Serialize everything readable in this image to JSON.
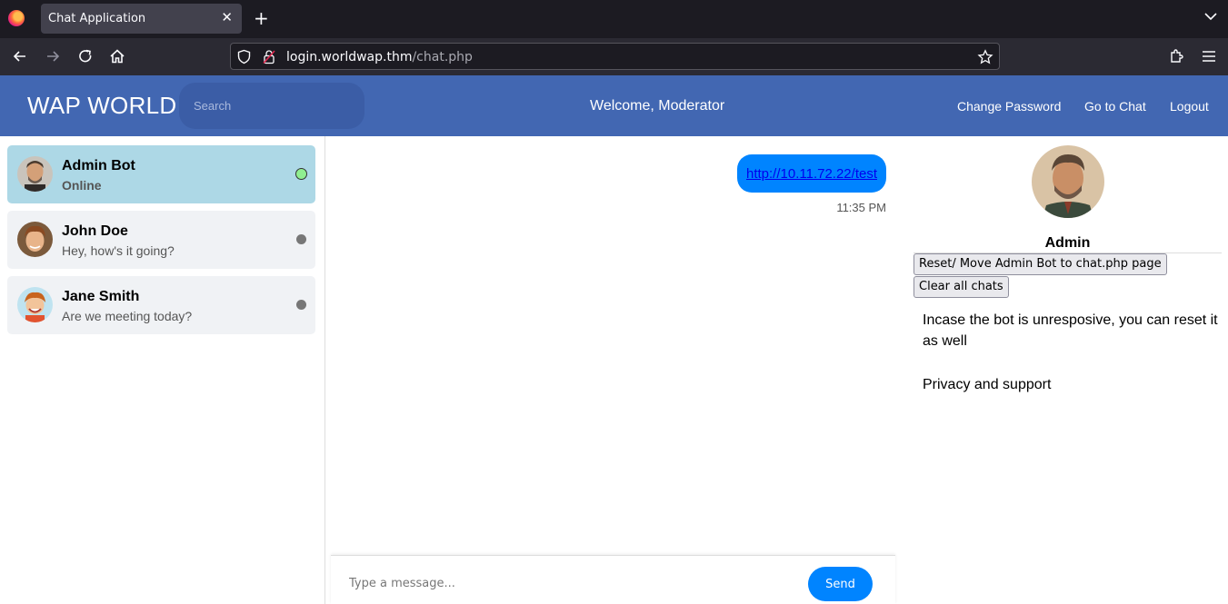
{
  "browser": {
    "tab_title": "Chat Application",
    "url_host": "login.worldwap.thm",
    "url_path": "/chat.php"
  },
  "header": {
    "brand": "WAP WORLD",
    "search_placeholder": "Search",
    "welcome": "Welcome, Moderator",
    "links": [
      "Change Password",
      "Go to Chat",
      "Logout"
    ]
  },
  "contacts": [
    {
      "name": "Admin Bot",
      "status": "Online",
      "online": true
    },
    {
      "name": "John Doe",
      "status": "Hey, how's it going?",
      "online": false
    },
    {
      "name": "Jane Smith",
      "status": "Are we meeting today?",
      "online": false
    }
  ],
  "chat": {
    "messages": [
      {
        "text": "http://10.11.72.22/test",
        "time": "11:35 PM"
      }
    ],
    "input_placeholder": "Type a message...",
    "send_label": "Send"
  },
  "profile": {
    "name": "Admin",
    "reset_button": "Reset/ Move Admin Bot to chat.php page",
    "clear_button": "Clear all chats",
    "info": "Incase the bot is unresposive, you can reset it as well",
    "privacy": "Privacy and support"
  },
  "colors": {
    "header_bg": "#4267b2",
    "active_contact": "#add8e6",
    "bubble": "#0084ff",
    "online_dot": "#90ee90"
  }
}
